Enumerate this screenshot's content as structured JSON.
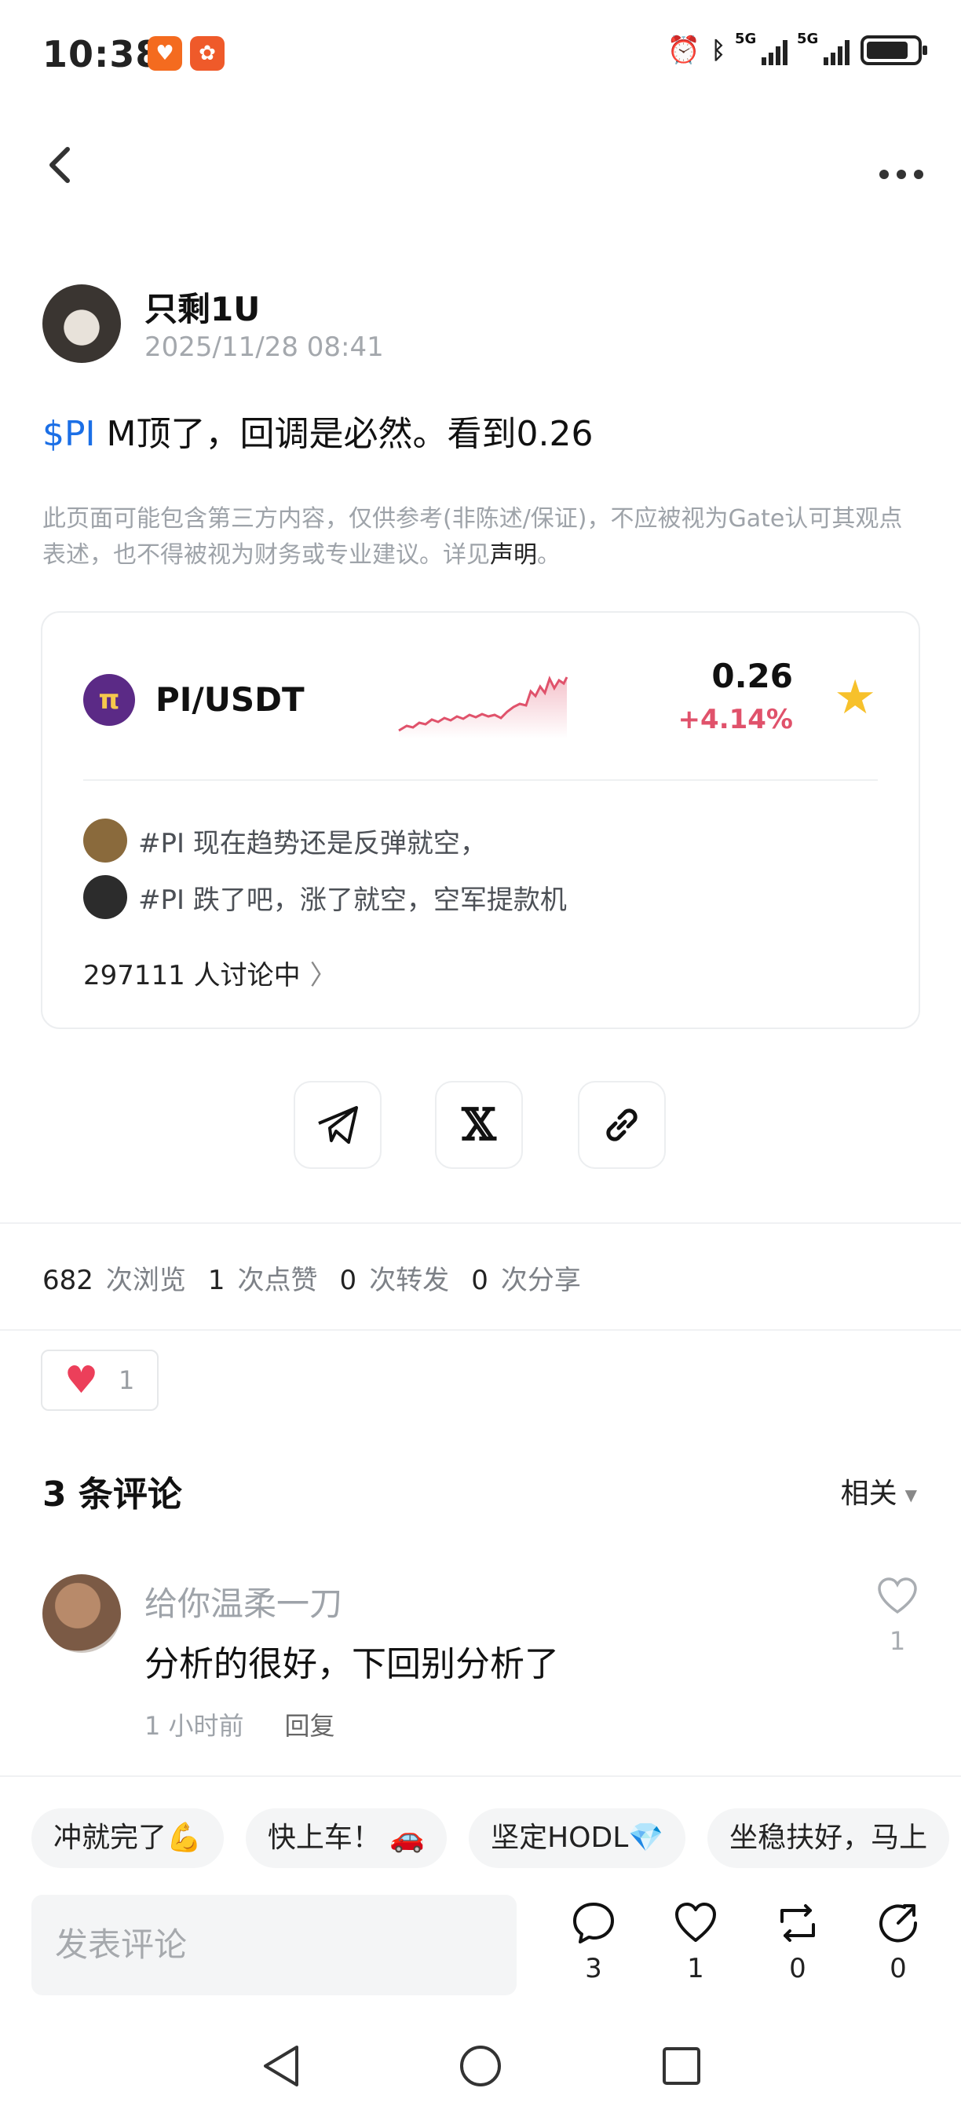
{
  "status_bar": {
    "time": "10:38",
    "signal1": "5G",
    "signal2": "5G"
  },
  "post": {
    "author": "只剩1U",
    "timestamp": "2025/11/28 08:41",
    "tag": "$PI",
    "text": " M顶了，回调是必然。看到0.26",
    "disclaimer": "此页面可能包含第三方内容，仅供参考(非陈述/保证)，不应被视为Gate认可其观点表述，也不得被视为财务或专业建议。详见",
    "disclaimer_link": "声明",
    "disclaimer_end": "。"
  },
  "market_card": {
    "pair": "PI/USDT",
    "price": "0.26",
    "change": "+4.14%",
    "discussions": [
      "#PI 现在趋势还是反弹就空，",
      "#PI 跌了吧，涨了就空，空军提款机"
    ],
    "discussing_count": "297111 人讨论中",
    "colors": {
      "up": "#e0526b",
      "star": "#f7c12b"
    }
  },
  "stats": {
    "views": "682",
    "views_label": "次浏览",
    "likes": "1",
    "likes_label": "次点赞",
    "reposts": "0",
    "reposts_label": "次转发",
    "shares": "0",
    "shares_label": "次分享"
  },
  "reaction": {
    "count": "1"
  },
  "comments": {
    "title": "3 条评论",
    "sort": "相关",
    "items": [
      {
        "name": "给你温柔一刀",
        "text": "分析的很好，下回别分析了",
        "time": "1 小时前",
        "reply": "回复",
        "likes": "1"
      }
    ]
  },
  "quick_replies": [
    "冲就完了💪",
    "快上车！ 🚗",
    "坚定HODL💎",
    "坐稳扶好，马上"
  ],
  "bottom_bar": {
    "placeholder": "发表评论",
    "comment_count": "3",
    "like_count": "1",
    "repost_count": "0",
    "share_count": "0"
  },
  "icons": {
    "back": "chevron-left-icon",
    "more": "more-dots-icon",
    "telegram": "telegram-icon",
    "x": "x-logo-icon",
    "link": "link-icon"
  }
}
